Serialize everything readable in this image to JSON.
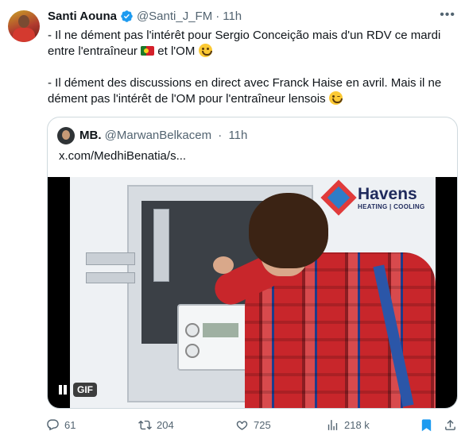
{
  "tweet": {
    "author_name": "Santi Aouna",
    "handle": "@Santi_J_FM",
    "separator": "·",
    "time": "11h",
    "line1_before_flag": "- Il ne dément pas l'intérêt pour Sergio Conceição mais d'un RDV ce mardi entre l'entraîneur",
    "line1_after_flag": "et l'OM",
    "line2": "- Il dément des discussions en direct avec Franck Haise en avril. Mais il ne dément pas l'intérêt de l'OM pour l'entraîneur lensois"
  },
  "quote": {
    "author_name": "MB.",
    "handle": "@MarwanBelkacem",
    "separator": "·",
    "time": "11h",
    "link_text": "x.com/MedhiBenatia/s...",
    "media_badge": "GIF",
    "ad_brand": "Havens",
    "ad_tagline": "HEATING | COOLING"
  },
  "actions": {
    "replies": "61",
    "reposts": "204",
    "likes": "725",
    "views": "218 k"
  },
  "colors": {
    "accent": "#1d9bf0",
    "muted": "#536471",
    "text": "#0f1419",
    "border": "#cfd9de"
  },
  "icons": [
    "verified-badge-icon",
    "more-icon",
    "reply-icon",
    "repost-icon",
    "like-icon",
    "views-icon",
    "bookmark-icon",
    "share-icon",
    "pause-icon",
    "portugal-flag-icon",
    "slightly-smiling-face-icon",
    "winking-face-icon"
  ]
}
